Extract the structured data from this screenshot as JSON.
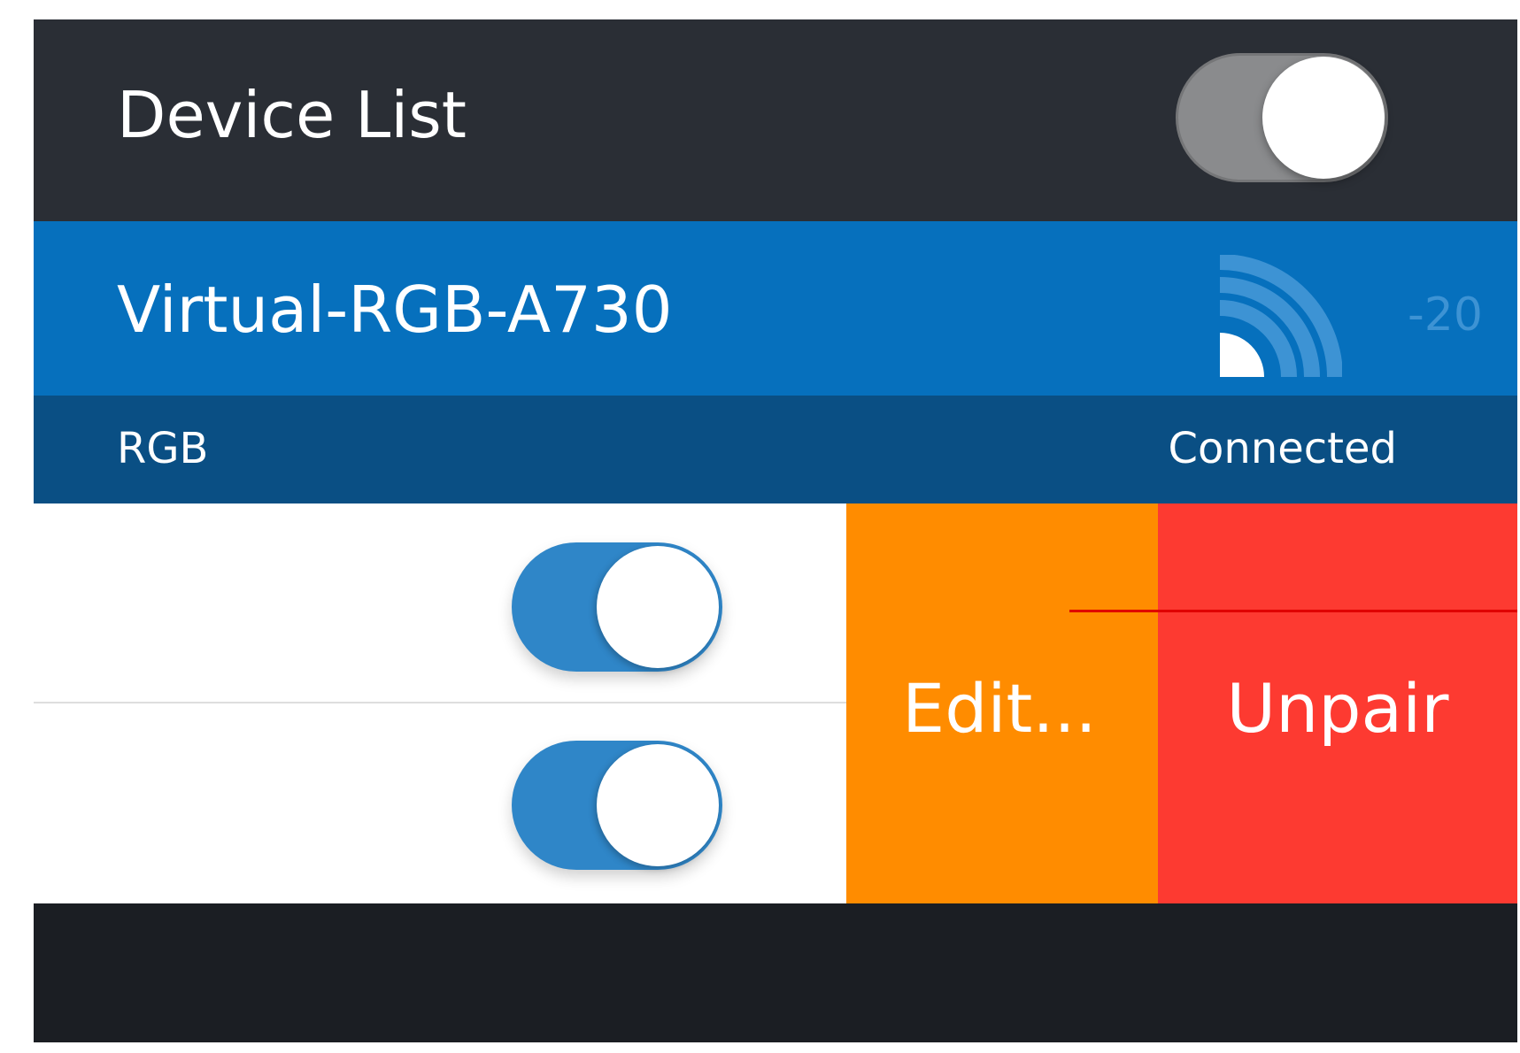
{
  "header": {
    "title": "Device List",
    "scan_toggle_on": true
  },
  "device": {
    "name": "Virtual-RGB-A730",
    "signal_icon": "signal-strength-icon",
    "rssi": "-20",
    "type": "RGB",
    "status": "Connected"
  },
  "rows": [
    {
      "toggle_on": true
    },
    {
      "toggle_on": true
    }
  ],
  "actions": {
    "edit_label": "Edit...",
    "unpair_label": "Unpair"
  },
  "colors": {
    "header_bg": "#2a2e35",
    "device_bg": "#0670bd",
    "device_sub_bg": "#0a4f84",
    "toggle_on": "#2f86c8",
    "toggle_off": "#8a8b8d",
    "edit_bg": "#ff8c00",
    "unpair_bg": "#fd3a31",
    "footer_bg": "#1b1e23"
  }
}
